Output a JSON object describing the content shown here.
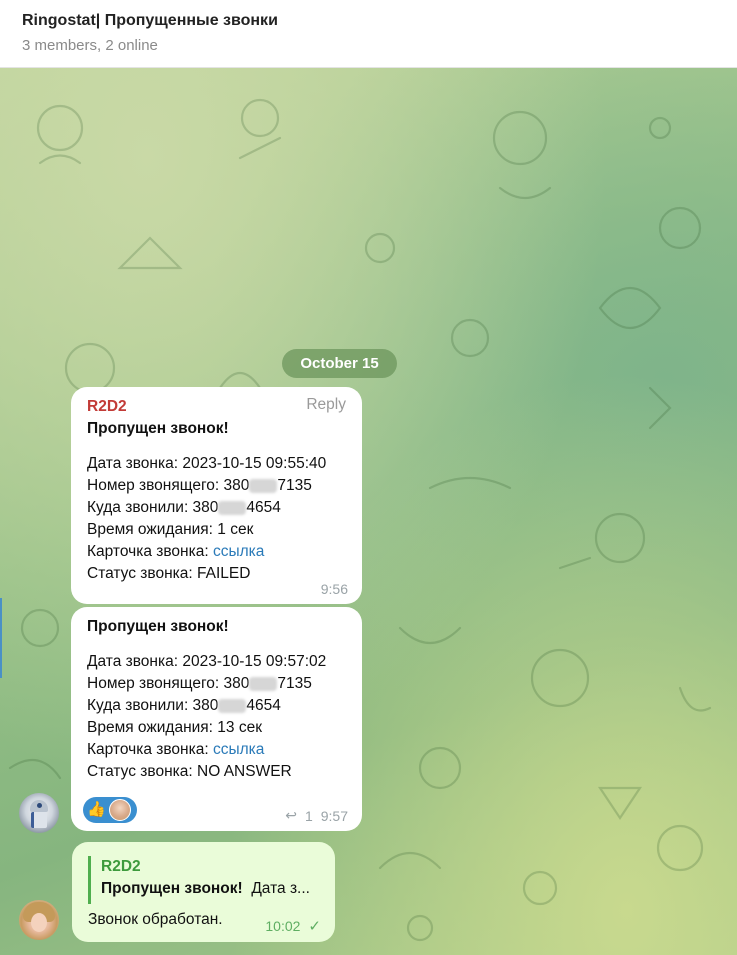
{
  "header": {
    "title": "Ringostat| Пропущенные звонки",
    "subtitle": "3 members, 2 online"
  },
  "date_separator": "October 15",
  "messages": [
    {
      "sender": "R2D2",
      "reply_label": "Reply",
      "heading": "Пропущен звонок!",
      "date_line": "Дата звонка: 2023-10-15 09:55:40",
      "caller_prefix": "Номер звонящего: 380",
      "caller_suffix": "7135",
      "callee_prefix": "Куда звонили: 380",
      "callee_suffix": "4654",
      "wait_line": "Время ожидания: 1 сек",
      "card_label": "Карточка звонка: ",
      "card_link": "ссылка",
      "status_line": "Статус звонка: FAILED",
      "time": "9:56"
    },
    {
      "heading": "Пропущен звонок!",
      "date_line": "Дата звонка: 2023-10-15 09:57:02",
      "caller_prefix": "Номер звонящего: 380",
      "caller_suffix": "7135",
      "callee_prefix": "Куда звонили: 380",
      "callee_suffix": "4654",
      "wait_line": "Время ожидания: 13 сек",
      "card_label": "Карточка звонка: ",
      "card_link": "ссылка",
      "status_line": "Статус звонка: NO ANSWER",
      "reaction_emoji": "👍",
      "reply_count": "1",
      "time": "9:57"
    },
    {
      "quote_sender": "R2D2",
      "quote_bold": "Пропущен звонок!",
      "quote_rest": "Дата з...",
      "text": "Звонок обработан.",
      "time": "10:02",
      "status_icon": "✓"
    }
  ],
  "colors": {
    "sender_red": "#c23b37",
    "link_blue": "#2a7ab8",
    "outgoing_bg": "#eafcd9",
    "reaction_blue": "#3a8fd0"
  }
}
